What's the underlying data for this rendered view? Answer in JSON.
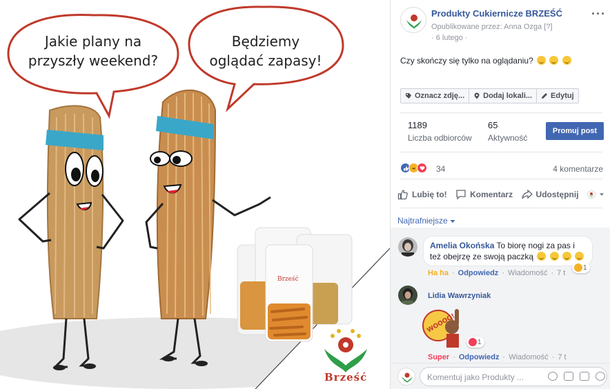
{
  "image": {
    "bubble_left": "Jakie plany na przyszły weekend?",
    "bubble_left_line1": "Jakie plany na",
    "bubble_left_line2": "przyszły weekend?",
    "bubble_right_line1": "Będziemy",
    "bubble_right_line2": "oglądać zapasy!",
    "brand_text": "Brześć",
    "package_label": "Brześć",
    "bubble_color": "#c0392b",
    "headband_color": "#3aa7c9",
    "brand_color": "#c0392b"
  },
  "post": {
    "page_name": "Produkty Cukiernicze BRZEŚĆ",
    "posted_by": "Opublikowane przez: Anna Ozga",
    "posted_by_help": "[?]",
    "date": "· 6 lutego ·",
    "text": "Czy skończy się tylko na oglądaniu?",
    "more_icon": "···"
  },
  "action_bar": {
    "tag": "Oznacz zdję...",
    "location": "Dodaj lokali...",
    "edit": "Edytuj"
  },
  "stats": {
    "reach_value": "1189",
    "reach_label": "Liczba odbiorców",
    "engagement_value": "65",
    "engagement_label": "Aktywność",
    "promote_label": "Promuj post"
  },
  "reactions": {
    "count": "34",
    "comments": "4 komentarze"
  },
  "buttons": {
    "like": "Lubię to!",
    "comment": "Komentarz",
    "share": "Udostępnij"
  },
  "sort": {
    "label": "Najtrafniejsze"
  },
  "comments": [
    {
      "author": "Amelia Okońska",
      "text": "To biorę nogi za pas i też obejrzę ze swoją paczką",
      "reaction": "Ha ha",
      "reply": "Odpowiedz",
      "message": "Wiadomość",
      "time": "7 t",
      "badge_count": "1"
    },
    {
      "author": "Lidia Wawrzyniak",
      "sticker_text": "WOOOO!",
      "reaction": "Super",
      "reply": "Odpowiedz",
      "message": "Wiadomość",
      "time": "7 t",
      "badge_count": "1"
    }
  ],
  "compose": {
    "placeholder": "Komentuj jako Produkty ..."
  },
  "colors": {
    "link_blue": "#365899",
    "button_blue": "#4267b2",
    "haha_orange": "#f7b125",
    "love_red": "#f33e58"
  }
}
